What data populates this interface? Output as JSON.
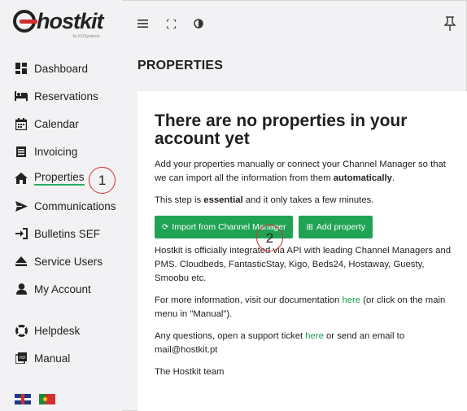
{
  "app": {
    "logo_text": "hostkit",
    "logo_sub": "by KOSystems"
  },
  "sidebar": {
    "items": [
      {
        "label": "Dashboard",
        "icon": "dashboard-icon"
      },
      {
        "label": "Reservations",
        "icon": "bed-icon"
      },
      {
        "label": "Calendar",
        "icon": "calendar-icon"
      },
      {
        "label": "Invoicing",
        "icon": "invoice-icon"
      },
      {
        "label": "Properties",
        "icon": "home-icon",
        "active": true
      },
      {
        "label": "Communications",
        "icon": "send-icon"
      },
      {
        "label": "Bulletins SEF",
        "icon": "sign-in-icon"
      },
      {
        "label": "Service Users",
        "icon": "eject-icon"
      },
      {
        "label": "My Account",
        "icon": "user-icon"
      },
      {
        "label": "Helpdesk",
        "icon": "lifebuoy-icon"
      },
      {
        "label": "Manual",
        "icon": "pdf-icon"
      }
    ],
    "languages": [
      "English",
      "Português"
    ]
  },
  "topbar": {
    "icons": [
      "menu-icon",
      "fullscreen-icon",
      "contrast-icon",
      "pin-icon"
    ]
  },
  "page": {
    "title": "PROPERTIES"
  },
  "empty_state": {
    "heading": "There are no properties in your account yet",
    "intro_before": "Add your properties manually or connect your Channel Manager so that we can import all the information from them ",
    "intro_bold": "automatically",
    "intro_after": ".",
    "step_before": "This step is ",
    "step_bold": "essential",
    "step_after": " and it only takes a few minutes.",
    "import_button": "Import from Channel Manager",
    "add_button": "Add property",
    "integration_text": "Hostkit is officially integrated via API with leading Channel Managers and PMS. Cloudbeds, FantasticStay, Kigo, Beds24, Hostaway, Guesty, Smoobu etc.",
    "docs_before": "For more information, visit our documentation ",
    "docs_link": "here",
    "docs_after": " (or click on the main menu in \"Manual\").",
    "support_before": "Any questions, open a support ticket ",
    "support_link": "here",
    "support_after": " or send an email to mail@hostkit.pt",
    "signoff": "The Hostkit team"
  },
  "annotations": [
    "1",
    "2"
  ],
  "colors": {
    "accent": "#21a355",
    "link": "#1e9e4a",
    "marker": "#d32f2f"
  }
}
